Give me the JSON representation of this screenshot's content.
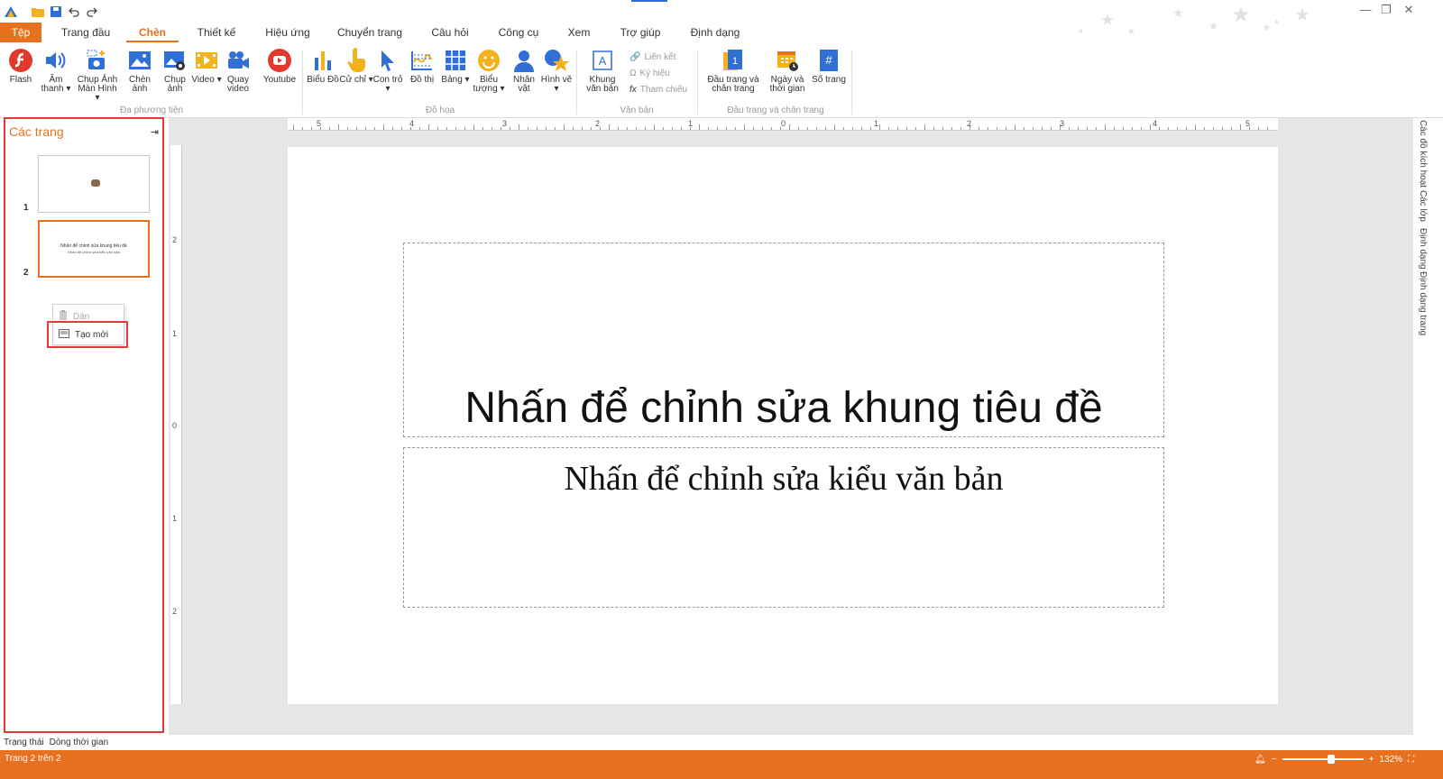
{
  "titlebar": {
    "minimize": "—",
    "restore": "❐",
    "close": "✕"
  },
  "tabs": [
    {
      "label": "Tệp"
    },
    {
      "label": "Trang đầu"
    },
    {
      "label": "Chèn"
    },
    {
      "label": "Thiết kế"
    },
    {
      "label": "Hiệu ứng"
    },
    {
      "label": "Chuyển trang"
    },
    {
      "label": "Câu hỏi"
    },
    {
      "label": "Công cụ"
    },
    {
      "label": "Xem"
    },
    {
      "label": "Trợ giúp"
    },
    {
      "label": "Định dạng"
    }
  ],
  "ribbon": {
    "media": {
      "group": "Đa phương tiện",
      "flash": "Flash",
      "audio": "Âm thanh ▾",
      "screenshot": "Chụp Ảnh Màn Hình ▾",
      "insert_image": "Chèn ảnh",
      "capture_image": "Chụp ảnh",
      "video": "Video ▾",
      "record_video": "Quay video",
      "youtube": "Youtube"
    },
    "graphics": {
      "group": "Đồ họa",
      "chart": "Biểu Đồ",
      "gesture": "Cử chỉ ▾",
      "pointer": "Con trỏ ▾",
      "graph": "Đồ thị",
      "table": "Bảng ▾",
      "icon": "Biểu tượng ▾",
      "character": "Nhân vật",
      "shape": "Hình vẽ ▾"
    },
    "text": {
      "group": "Văn bản",
      "textbox": "Khung văn bản",
      "link": "Liên kết",
      "symbol": "Ký hiệu",
      "reference": "Tham chiếu"
    },
    "headerfooter": {
      "group": "Đầu trang và chân trang",
      "headerfooter": "Đầu trang và chân trang",
      "datetime": "Ngày và thời gian",
      "pagenum": "Số trang"
    }
  },
  "pages_panel": {
    "title": "Các trang",
    "pin": "⇥",
    "thumbs": [
      {
        "num": "1"
      },
      {
        "num": "2",
        "title": "Nhấn để chỉnh sửa khung tiêu đề",
        "sub": "Nhấn để chỉnh sửa kiểu văn bản"
      }
    ],
    "context_menu": {
      "paste": "Dán",
      "new": "Tạo mới"
    }
  },
  "ruler": {
    "h_labels": [
      "5",
      "4",
      "3",
      "2",
      "1",
      "0",
      "1",
      "2",
      "3",
      "4",
      "5"
    ],
    "v_labels": [
      "2",
      "1",
      "0",
      "1",
      "2"
    ]
  },
  "slide": {
    "title": "Nhấn để chỉnh sửa khung tiêu đề",
    "subtitle": "Nhấn để chỉnh sửa kiểu văn bản"
  },
  "right_panel": {
    "tabs": [
      "Các đồ kích hoạt",
      "Các lớp",
      "Định dạng",
      "Định dạng trang"
    ]
  },
  "bottom": {
    "tabs": [
      "Trạng thái",
      "Dòng thời gian"
    ],
    "status": "Trang 2 trên 2",
    "zoom": "132%",
    "zoom_fraction": 0.62
  },
  "colors": {
    "accent": "#e8711f",
    "highlight": "#e03a3a",
    "blue": "#2f6fd6"
  }
}
